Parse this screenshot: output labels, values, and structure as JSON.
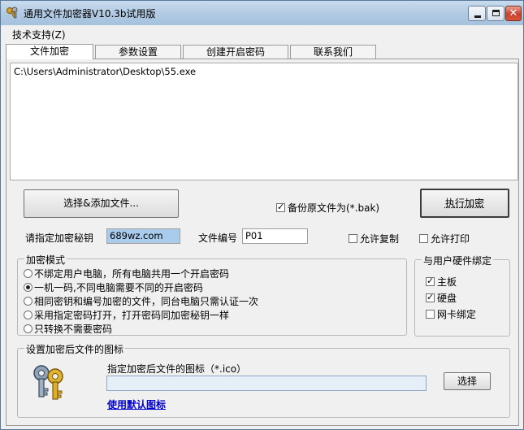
{
  "window": {
    "title": "通用文件加密器V10.3b试用版"
  },
  "menu": {
    "support": "技术支持(Z)"
  },
  "tabs": [
    {
      "label": "文件加密"
    },
    {
      "label": "参数设置"
    },
    {
      "label": "创建开启密码"
    },
    {
      "label": "联系我们"
    }
  ],
  "file_list": {
    "items": [
      "C:\\Users\\Administrator\\Desktop\\55.exe"
    ]
  },
  "actions": {
    "add_file": "选择&添加文件...",
    "backup_label": "备份原文件为(*.bak)",
    "backup_checked": true,
    "encrypt": "执行加密"
  },
  "key_row": {
    "key_label": "请指定加密秘钥",
    "key_value": "689wz.com",
    "file_no_label": "文件编号",
    "file_no_value": "P01",
    "allow_copy": "允许复制",
    "allow_copy_checked": false,
    "allow_print": "允许打印",
    "allow_print_checked": false
  },
  "mode_group": {
    "title": "加密模式",
    "options": [
      "不绑定用户电脑，所有电脑共用一个开启密码",
      "一机一码,不同电脑需要不同的开启密码",
      "相同密钥和编号加密的文件，同台电脑只需认证一次",
      "采用指定密码打开，打开密码同加密秘钥一样",
      "只转换不需要密码"
    ],
    "selected_index": 1
  },
  "hardware_group": {
    "title": "与用户硬件绑定",
    "items": [
      {
        "label": "主板",
        "checked": true
      },
      {
        "label": "硬盘",
        "checked": true
      },
      {
        "label": "网卡绑定",
        "checked": false
      }
    ]
  },
  "icon_group": {
    "title": "设置加密后文件的图标",
    "prompt": "指定加密后文件的图标（*.ico）",
    "path_value": "",
    "select_button": "选择",
    "default_link": "使用默认图标",
    "icon_name": "keys-icon"
  }
}
